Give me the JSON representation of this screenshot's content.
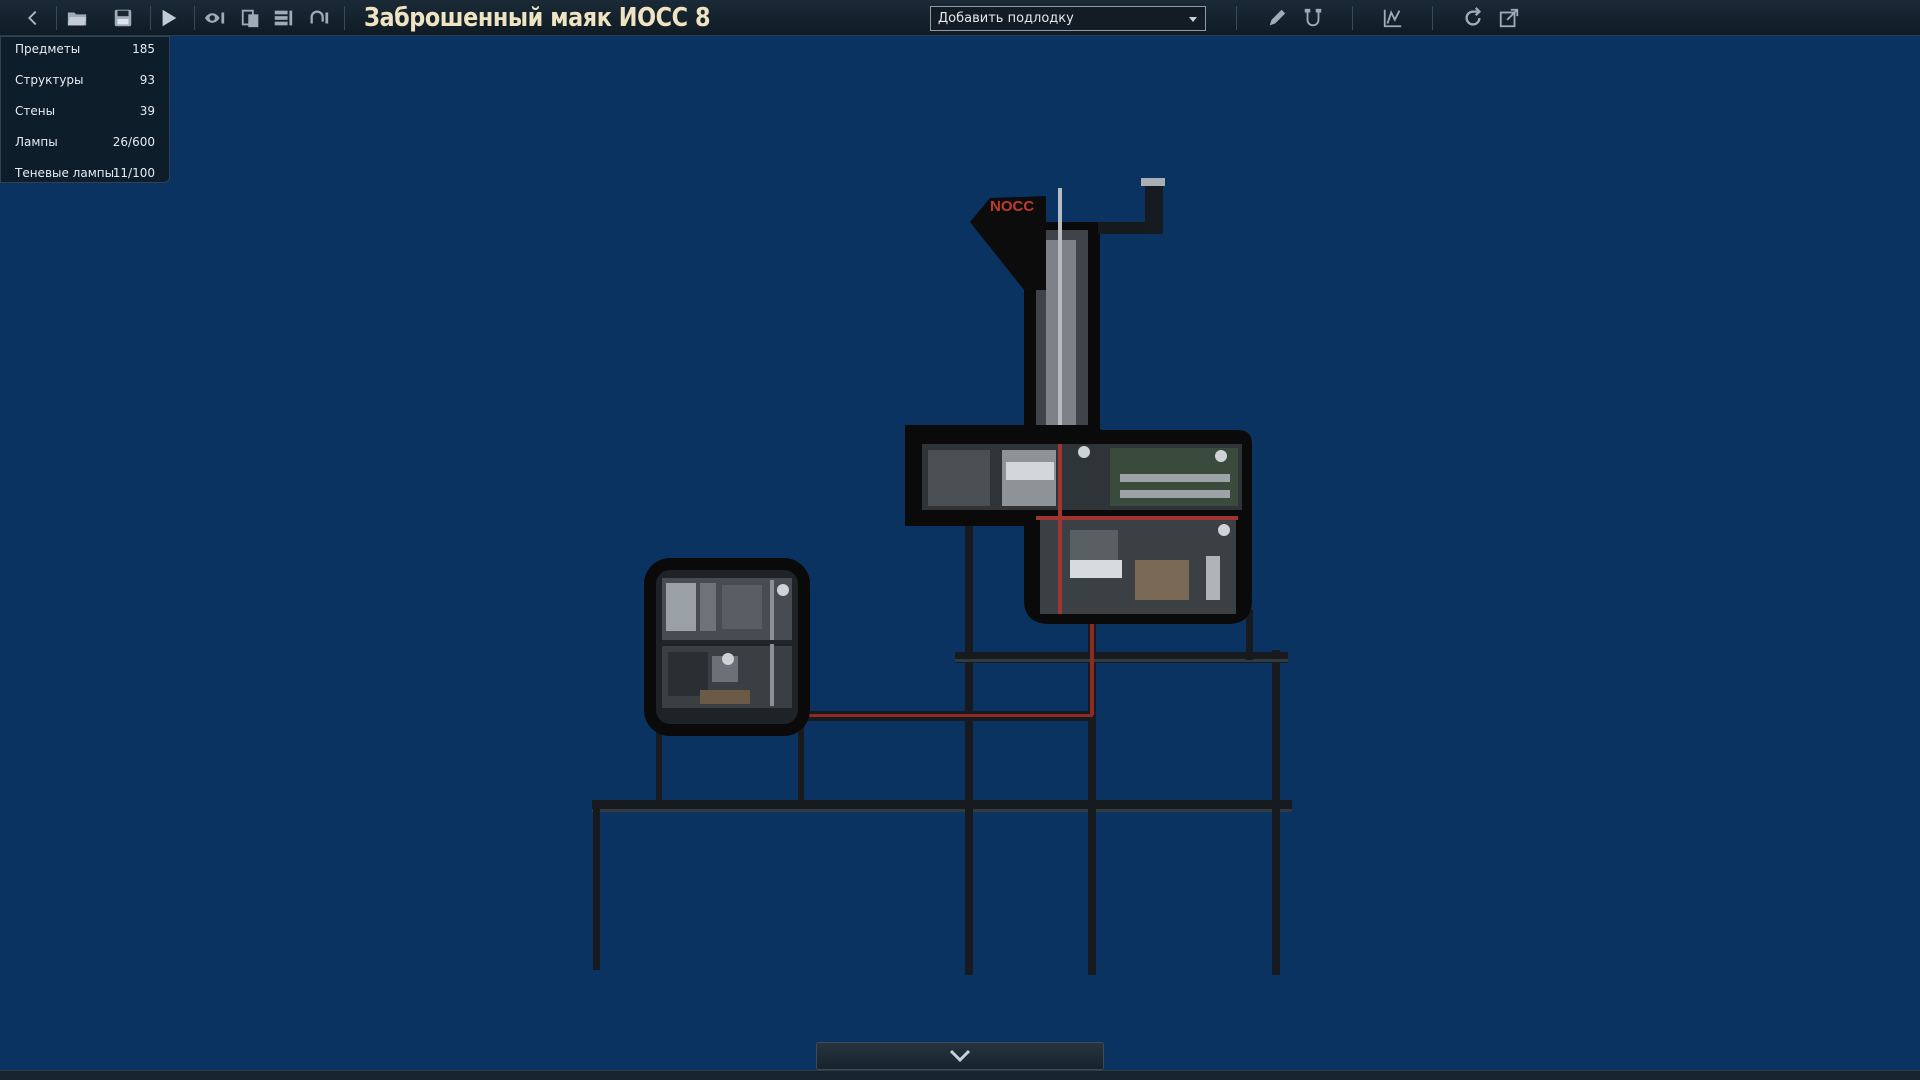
{
  "toolbar": {
    "title": "Заброшенный маяк ИОСС 8",
    "add_submarine": "Добавить подлодку"
  },
  "stats": [
    {
      "label": "Предметы",
      "value": "185"
    },
    {
      "label": "Структуры",
      "value": "93"
    },
    {
      "label": "Стены",
      "value": "39"
    },
    {
      "label": "Лампы",
      "value": "26/600"
    },
    {
      "label": "Теневые лампы",
      "value": "11/100"
    }
  ],
  "map": {
    "sign_text": "NOCC"
  },
  "colors": {
    "background": "#0b3361",
    "toolbar": "#131f29",
    "title": "#efe3c2",
    "hull": "#0a0a0a",
    "pipe_red": "#b0322a"
  },
  "icons": [
    "back-icon",
    "open-folder-icon",
    "save-icon",
    "play-icon",
    "visibility-icon",
    "copy-icon",
    "layers-icon",
    "undo-icon",
    "pencil-icon",
    "wiring-icon",
    "graph-icon",
    "refresh-icon",
    "export-icon",
    "chevron-down-icon"
  ]
}
